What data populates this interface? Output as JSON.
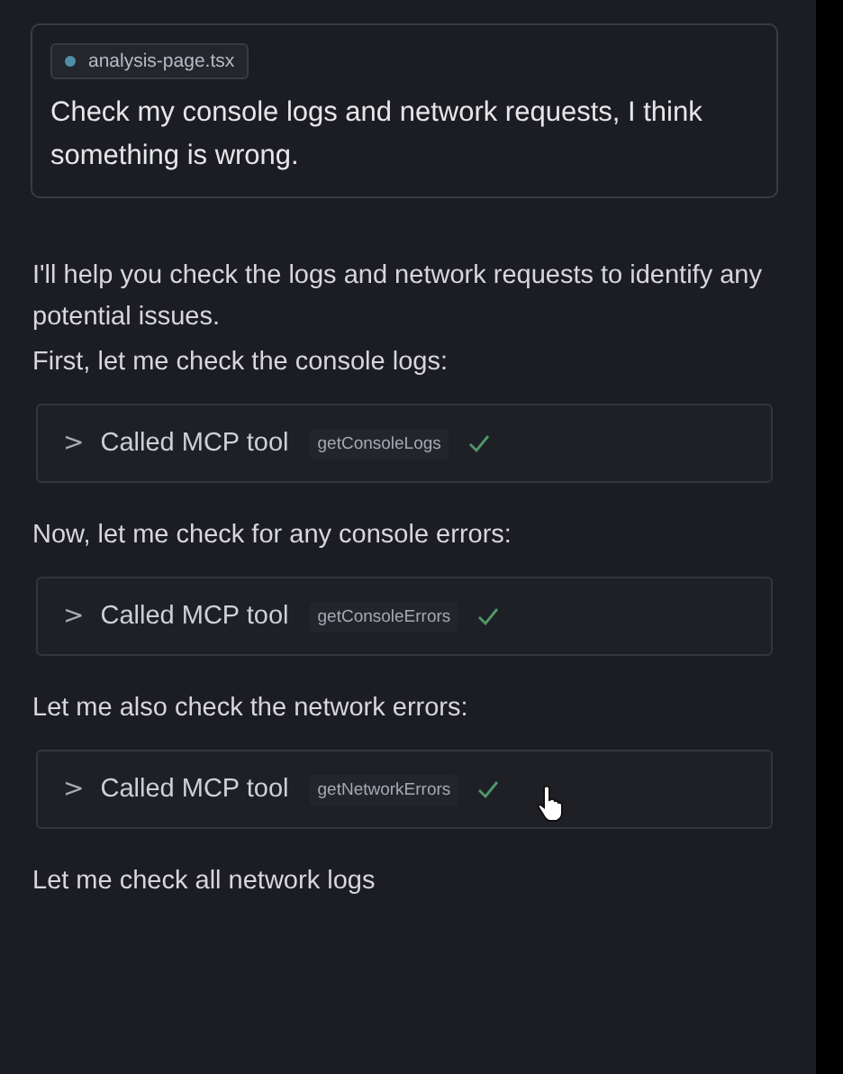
{
  "user_message": {
    "file_chip": "analysis-page.tsx",
    "text": "Check my console logs and network requests, I think something is wrong."
  },
  "messages": [
    {
      "kind": "text",
      "text": "I'll help you check the logs and network requests to identify any potential issues."
    },
    {
      "kind": "text",
      "text": "First, let me check the console logs:"
    },
    {
      "kind": "tool_call",
      "expand": ">",
      "label": "Called MCP tool",
      "tool": "getConsoleLogs",
      "completed": true,
      "cursor": false
    },
    {
      "kind": "text",
      "text": "Now, let me check for any console errors:"
    },
    {
      "kind": "tool_call",
      "expand": ">",
      "label": "Called MCP tool",
      "tool": "getConsoleErrors",
      "completed": true,
      "cursor": false
    },
    {
      "kind": "text",
      "text": "Let me also check the network errors:"
    },
    {
      "kind": "tool_call",
      "expand": ">",
      "label": "Called MCP tool",
      "tool": "getNetworkErrors",
      "completed": true,
      "cursor": true
    },
    {
      "kind": "text",
      "text": "Let me check all network logs"
    }
  ]
}
